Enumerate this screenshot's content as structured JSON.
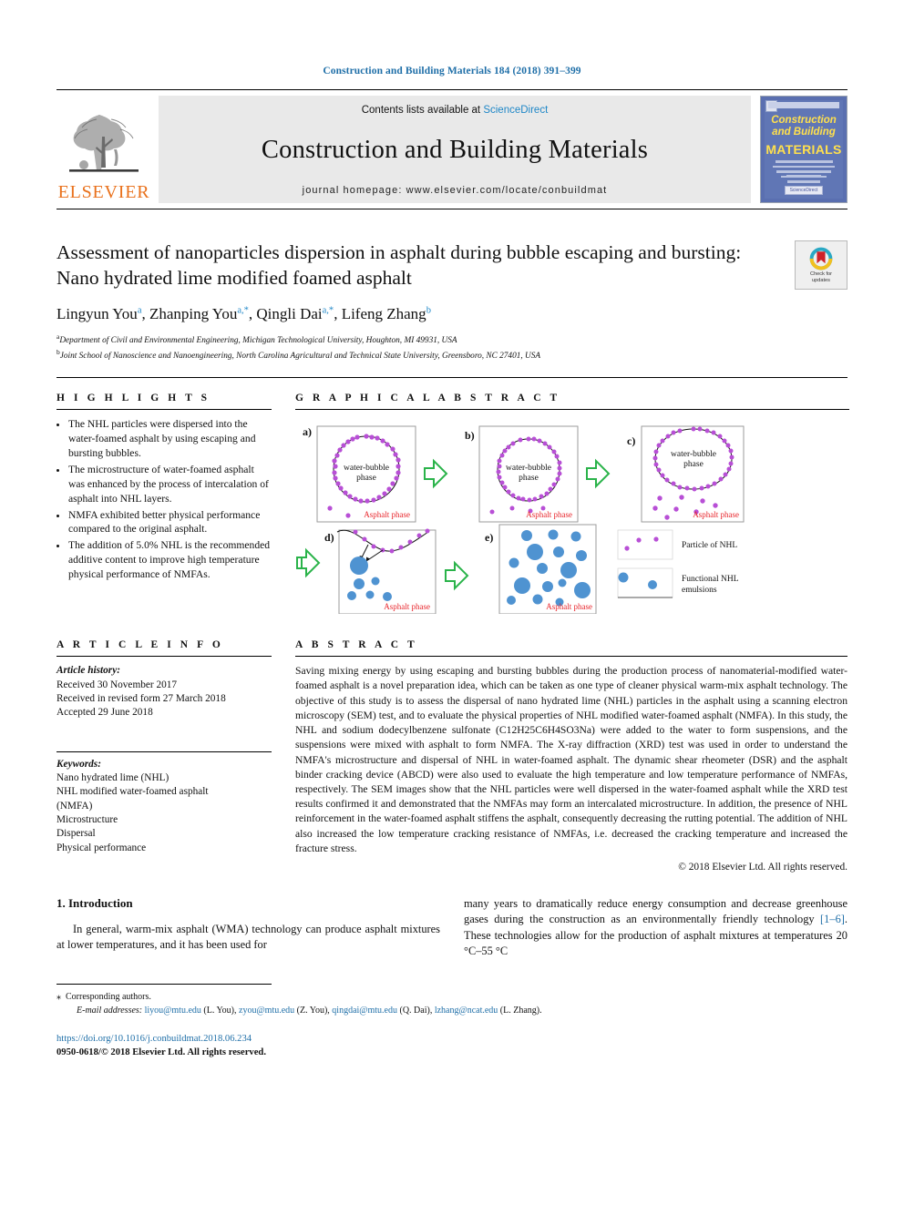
{
  "running_head": "Construction and Building Materials 184 (2018) 391–399",
  "masthead": {
    "publisher": "ELSEVIER",
    "contents_prefix": "Contents lists available at ",
    "contents_link": "ScienceDirect",
    "journal_name": "Construction and Building Materials",
    "homepage": "journal homepage: www.elsevier.com/locate/conbuildmat",
    "cover": {
      "line1": "Construction",
      "line2": "and Building",
      "line3": "MATERIALS",
      "footer_badge": "ScienceDirect"
    }
  },
  "title": "Assessment of nanoparticles dispersion in asphalt during bubble escaping and bursting: Nano hydrated lime modified foamed asphalt",
  "crossmark": {
    "line1": "Check for",
    "line2": "updates"
  },
  "authors": [
    {
      "name": "Lingyun You",
      "marks": "a"
    },
    {
      "name": "Zhanping You",
      "marks": "a,*"
    },
    {
      "name": "Qingli Dai",
      "marks": "a,*"
    },
    {
      "name": "Lifeng Zhang",
      "marks": "b"
    }
  ],
  "affiliations": [
    {
      "mark": "a",
      "text": "Department of Civil and Environmental Engineering, Michigan Technological University, Houghton, MI 49931, USA"
    },
    {
      "mark": "b",
      "text": "Joint School of Nanoscience and Nanoengineering, North Carolina Agricultural and Technical State University, Greensboro, NC 27401, USA"
    }
  ],
  "highlights": {
    "heading": "H I G H L I G H T S",
    "items": [
      "The NHL particles were dispersed into the water-foamed asphalt by using escaping and bursting bubbles.",
      "The microstructure of water-foamed asphalt was enhanced by the process of intercalation of asphalt into NHL layers.",
      "NMFA exhibited better physical performance compared to the original asphalt.",
      "The addition of 5.0% NHL is the recommended additive content to improve high temperature physical performance of NMFAs."
    ]
  },
  "article_info": {
    "heading": "A R T I C L E   I N F O",
    "history_label": "Article history:",
    "history": [
      "Received 30 November 2017",
      "Received in revised form 27 March 2018",
      "Accepted 29 June 2018"
    ],
    "keywords_label": "Keywords:",
    "keywords": [
      "Nano hydrated lime (NHL)",
      "NHL modified water-foamed asphalt",
      "(NMFA)",
      "Microstructure",
      "Dispersal",
      "Physical performance"
    ]
  },
  "graphical_abstract": {
    "heading": "G R A P H I C A L   A B S T R A C T",
    "panels": [
      {
        "id": "a)",
        "bubble_label": "water-bubble\nphase",
        "phase_label": "Asphalt phase"
      },
      {
        "id": "b)",
        "bubble_label": "water-bubble\nphase",
        "phase_label": "Asphalt phase"
      },
      {
        "id": "c)",
        "bubble_label": "water-bubble\nphase",
        "phase_label": "Asphalt phase"
      },
      {
        "id": "d)",
        "bubble_label": "",
        "phase_label": "Asphalt phase"
      },
      {
        "id": "e)",
        "bubble_label": "",
        "phase_label": "Asphalt phase"
      }
    ],
    "legend": [
      {
        "label": "Particle of NHL",
        "color": "#b84fd6"
      },
      {
        "label": "Functional NHL emulsions",
        "color": "#4f93d1"
      }
    ]
  },
  "abstract": {
    "heading": "A B S T R A C T",
    "text": "Saving mixing energy by using escaping and bursting bubbles during the production process of nanomaterial-modified water-foamed asphalt is a novel preparation idea, which can be taken as one type of cleaner physical warm-mix asphalt technology. The objective of this study is to assess the dispersal of nano hydrated lime (NHL) particles in the asphalt using a scanning electron microscopy (SEM) test, and to evaluate the physical properties of NHL modified water-foamed asphalt (NMFA). In this study, the NHL and sodium dodecylbenzene sulfonate (C12H25C6H4SO3Na) were added to the water to form suspensions, and the suspensions were mixed with asphalt to form NMFA. The X-ray diffraction (XRD) test was used in order to understand the NMFA's microstructure and dispersal of NHL in water-foamed asphalt. The dynamic shear rheometer (DSR) and the asphalt binder cracking device (ABCD) were also used to evaluate the high temperature and low temperature performance of NMFAs, respectively. The SEM images show that the NHL particles were well dispersed in the water-foamed asphalt while the XRD test results confirmed it and demonstrated that the NMFAs may form an intercalated microstructure. In addition, the presence of NHL reinforcement in the water-foamed asphalt stiffens the asphalt, consequently decreasing the rutting potential. The addition of NHL also increased the low temperature cracking resistance of NMFAs, i.e. decreased the cracking temperature and increased the fracture stress.",
    "copyright": "© 2018 Elsevier Ltd. All rights reserved."
  },
  "introduction": {
    "heading": "1. Introduction",
    "left_paragraph": "In general, warm-mix asphalt (WMA) technology can produce asphalt mixtures at lower temperatures, and it has been used for",
    "right_paragraph_part1": "many years to dramatically reduce energy consumption and decrease greenhouse gases during the construction as an environmentally friendly technology ",
    "right_reference": "[1–6]",
    "right_paragraph_part2": ". These technologies allow for the production of asphalt mixtures at temperatures 20 °C–55 °C"
  },
  "footnotes": {
    "corresponding": "Corresponding authors.",
    "email_label": "E-mail addresses:",
    "emails": [
      {
        "address": "liyou@mtu.edu",
        "who": "(L. You)"
      },
      {
        "address": "zyou@mtu.edu",
        "who": "(Z. You)"
      },
      {
        "address": "qingdai@mtu.edu",
        "who": "(Q. Dai)"
      },
      {
        "address": "lzhang@ncat.edu",
        "who": "(L. Zhang)"
      }
    ],
    "doi": "https://doi.org/10.1016/j.conbuildmat.2018.06.234",
    "issn": "0950-0618/© 2018 Elsevier Ltd. All rights reserved."
  },
  "colors": {
    "link_blue": "#1f6fa8",
    "sciencedirect_blue": "#1f87c7",
    "elsevier_orange": "#E9711C",
    "nhl_purple": "#b84fd6",
    "emulsion_blue": "#4f93d1",
    "arrow_green": "#22b14c",
    "asphalt_red": "#e8262c"
  }
}
